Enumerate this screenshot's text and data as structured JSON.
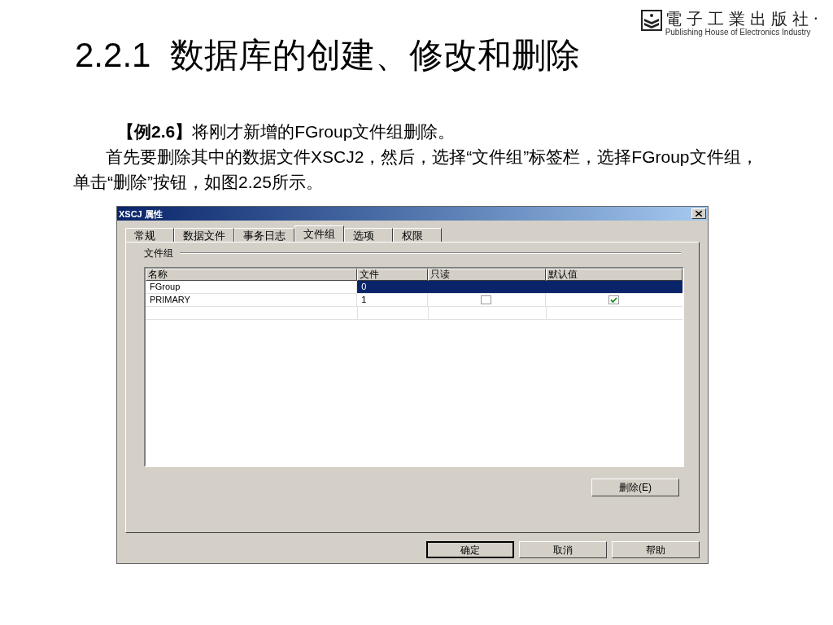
{
  "publisher": {
    "name": "電子工業出版社·",
    "subtitle": "Publishing House of Electronics Industry"
  },
  "title": "2.2.1  数据库的创建、修改和删除",
  "paragraphs": [
    "**【例2.6】**将刚才新增的FGroup文件组删除。",
    "首先要删除其中的数据文件XSCJ2，然后，选择“文件组”标签栏，选择FGroup文件组，单击“删除”按钮，如图2.25所示。"
  ],
  "dialog": {
    "title": "XSCJ 属性",
    "tabs": [
      {
        "label": "常规",
        "selected": false
      },
      {
        "label": "数据文件",
        "selected": false
      },
      {
        "label": "事务日志",
        "selected": false
      },
      {
        "label": "文件组",
        "selected": true
      },
      {
        "label": "选项",
        "selected": false
      },
      {
        "label": "权限",
        "selected": false
      }
    ],
    "group_label": "文件组",
    "table": {
      "columns": [
        "名称",
        "文件",
        "只读",
        "默认值"
      ],
      "rows": [
        {
          "name": "FGroup",
          "files": "0",
          "selected": true
        },
        {
          "name": "PRIMARY",
          "files": "1",
          "selected": false,
          "read_only": false,
          "default": true
        }
      ]
    },
    "delete_button": "删除(E)",
    "buttons": [
      {
        "label": "确定",
        "default": true
      },
      {
        "label": "取消",
        "default": false
      },
      {
        "label": "帮助",
        "default": false
      }
    ]
  }
}
